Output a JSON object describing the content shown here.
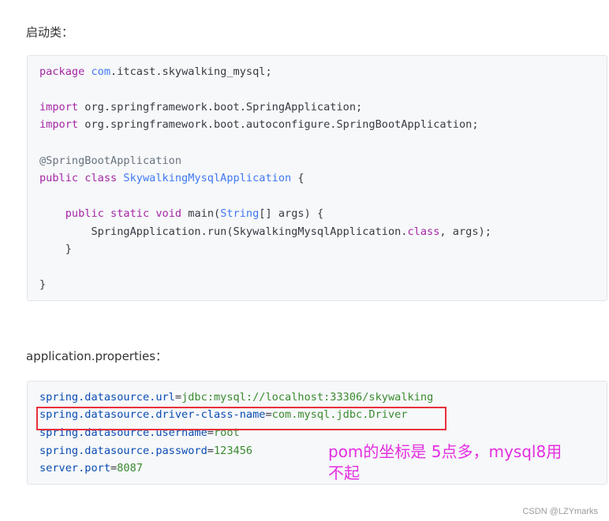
{
  "section1": {
    "heading": "启动类："
  },
  "code1": {
    "line1_kw": "package",
    "line1_pkg": "com",
    "line1_rest": ".itcast.skywalking_mysql;",
    "line2_kw": "import",
    "line2_rest": " org.springframework.boot.SpringApplication;",
    "line3_kw": "import",
    "line3_rest": " org.springframework.boot.autoconfigure.SpringBootApplication;",
    "line4_ann": "@SpringBootApplication",
    "line5_kw": "public class",
    "line5_cls": " SkywalkingMysqlApplication",
    "line5_rest": " {",
    "line6_indent": "    ",
    "line6_kw": "public static void",
    "line6_rest_a": " main(",
    "line6_type": "String",
    "line6_rest_b": "[] args) {",
    "line7_rest_a": "        SpringApplication.run(SkywalkingMysqlApplication.",
    "line7_kw": "class",
    "line7_rest_b": ", args);",
    "line8": "    }",
    "line9": "}"
  },
  "section2": {
    "heading": "application.properties："
  },
  "code2": {
    "l1_key": "spring.datasource.url",
    "l1_eq": "=",
    "l1_val_a": "jdbc",
    "l1_val_b": ":mysql://localhost:33306/skywalking",
    "l2_key": "spring.datasource.driver-class-name",
    "l2_eq": "=",
    "l2_val": "com.mysql.jdbc.Driver",
    "l3_key": "spring.datasource.username",
    "l3_eq": "=",
    "l3_val": "root",
    "l4_key": "spring.datasource.password",
    "l4_eq": "=",
    "l4_val": "123456",
    "l5_key": "server.port",
    "l5_eq": "=",
    "l5_val": "8087"
  },
  "annotation": {
    "line1": "pom的坐标是 5点多，mysql8用",
    "line2": "不起"
  },
  "footer": {
    "watermark": "CSDN @LZYmarks"
  },
  "colors": {
    "highlight_border": "#e8303b",
    "note_text": "#e52ee0"
  }
}
